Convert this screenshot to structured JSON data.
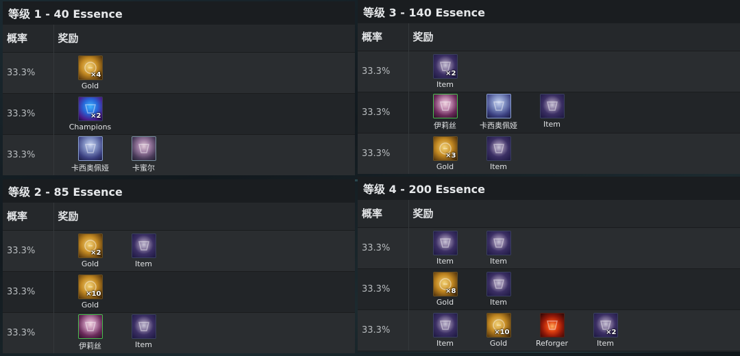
{
  "header": {
    "prob": "概率",
    "reward": "奖励"
  },
  "tiers": [
    {
      "title": "等级 1 - 40 Essence",
      "rows": [
        {
          "prob": "33.3%",
          "rewards": [
            {
              "icon": "gold-icon",
              "kind": "gold",
              "qty": "×4",
              "label": "Gold"
            }
          ]
        },
        {
          "prob": "33.3%",
          "rewards": [
            {
              "icon": "champion-icon",
              "kind": "champ",
              "qty": "×2",
              "label": "Champions"
            }
          ]
        },
        {
          "prob": "33.3%",
          "rewards": [
            {
              "icon": "kassadin-icon",
              "kind": "kass",
              "qty": "",
              "label": "卡西奥佩娅"
            },
            {
              "icon": "kaisa-icon",
              "kind": "kai",
              "qty": "",
              "label": "卡蜜尔"
            }
          ]
        }
      ]
    },
    {
      "title": "等级 2 - 85 Essence",
      "rows": [
        {
          "prob": "33.3%",
          "rewards": [
            {
              "icon": "gold-icon",
              "kind": "gold",
              "qty": "×2",
              "label": "Gold"
            },
            {
              "icon": "item-icon",
              "kind": "item",
              "qty": "",
              "label": "Item"
            }
          ]
        },
        {
          "prob": "33.3%",
          "rewards": [
            {
              "icon": "gold-icon",
              "kind": "gold",
              "qty": "×10",
              "label": "Gold"
            }
          ]
        },
        {
          "prob": "33.3%",
          "rewards": [
            {
              "icon": "elise-icon",
              "kind": "elise",
              "qty": "",
              "label": "伊莉丝"
            },
            {
              "icon": "item-icon",
              "kind": "item",
              "qty": "",
              "label": "Item"
            }
          ]
        }
      ]
    },
    {
      "title": "等级 3 - 140 Essence",
      "rows": [
        {
          "prob": "33.3%",
          "rewards": [
            {
              "icon": "item-icon",
              "kind": "item",
              "qty": "×2",
              "label": "Item"
            }
          ]
        },
        {
          "prob": "33.3%",
          "rewards": [
            {
              "icon": "elise-icon",
              "kind": "elise",
              "qty": "",
              "label": "伊莉丝"
            },
            {
              "icon": "kassadin-icon",
              "kind": "kass",
              "qty": "",
              "label": "卡西奥佩娅"
            },
            {
              "icon": "item-icon",
              "kind": "item",
              "qty": "",
              "label": "Item"
            }
          ]
        },
        {
          "prob": "33.3%",
          "rewards": [
            {
              "icon": "gold-icon",
              "kind": "gold",
              "qty": "×3",
              "label": "Gold"
            },
            {
              "icon": "item-icon",
              "kind": "item",
              "qty": "",
              "label": "Item"
            }
          ]
        }
      ]
    },
    {
      "title": "等级 4 - 200 Essence",
      "rows": [
        {
          "prob": "33.3%",
          "rewards": [
            {
              "icon": "item-icon",
              "kind": "item",
              "qty": "",
              "label": "Item"
            },
            {
              "icon": "item-icon",
              "kind": "item",
              "qty": "",
              "label": "Item"
            }
          ]
        },
        {
          "prob": "33.3%",
          "rewards": [
            {
              "icon": "gold-icon",
              "kind": "gold",
              "qty": "×8",
              "label": "Gold"
            },
            {
              "icon": "item-icon",
              "kind": "item",
              "qty": "",
              "label": "Item"
            }
          ]
        },
        {
          "prob": "33.3%",
          "rewards": [
            {
              "icon": "item-icon",
              "kind": "item",
              "qty": "",
              "label": "Item"
            },
            {
              "icon": "gold-icon",
              "kind": "gold",
              "qty": "×10",
              "label": "Gold"
            },
            {
              "icon": "reforger-icon",
              "kind": "reforger",
              "qty": "",
              "label": "Reforger"
            },
            {
              "icon": "item-icon",
              "kind": "item",
              "qty": "×2",
              "label": "Item"
            }
          ]
        }
      ]
    }
  ]
}
